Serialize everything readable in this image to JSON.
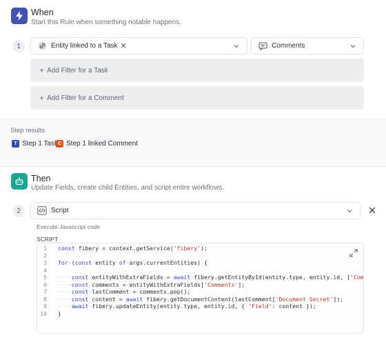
{
  "when": {
    "title": "When",
    "subtitle": "Start this Rule when something notable happens.",
    "step_number": "1",
    "entity_select": "Entity linked to a Task",
    "type_select": "Comments",
    "filters": [
      "Add Filter for a Task",
      "Add Filter for a Comment"
    ]
  },
  "results": {
    "label": "Step results",
    "chips": [
      {
        "badge": "T",
        "label": "Step 1 Task",
        "color": "#3b4ab0"
      },
      {
        "badge": "C",
        "label": "Step 1 linked Comment",
        "color": "#e05a25"
      }
    ]
  },
  "then": {
    "title": "Then",
    "subtitle": "Update Fields, create child Entities, and script entire workflows.",
    "step_number": "2",
    "action_select": "Script",
    "description": "Execute Javascript code",
    "script_label": "SCRIPT"
  },
  "code": {
    "line_numbers": [
      "1",
      "2",
      "3",
      "4",
      "5",
      "6",
      "7",
      "8",
      "9",
      "10"
    ]
  },
  "colors": {
    "when_icon": "#4352b6",
    "then_icon": "#1aa792"
  }
}
